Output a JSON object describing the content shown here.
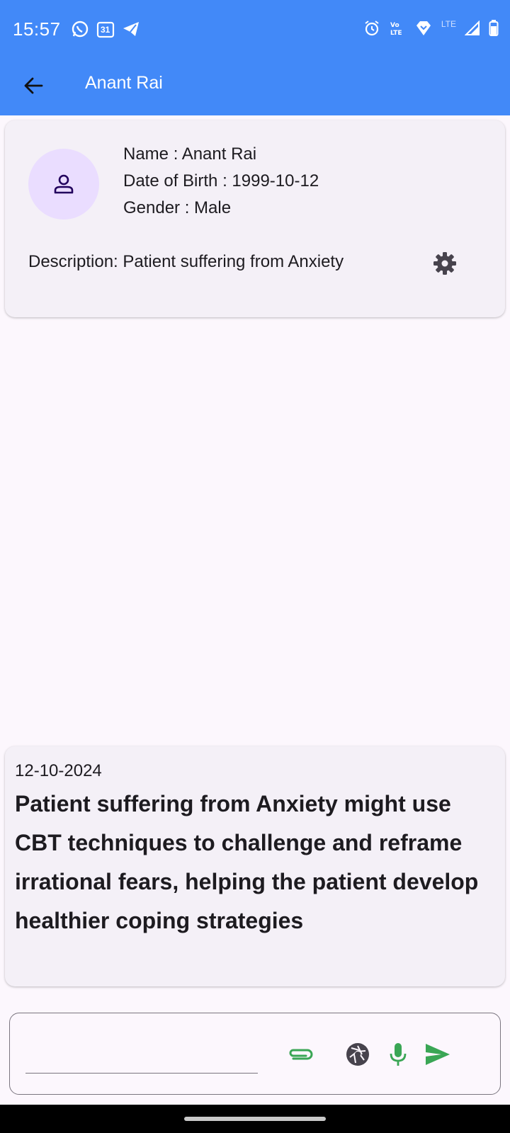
{
  "status_bar": {
    "time": "15:57",
    "left_icons": [
      "whatsapp-icon",
      "calendar-icon",
      "telegram-icon"
    ],
    "calendar_day": "31",
    "right_icons": [
      "alarm-icon",
      "volte-icon",
      "data-icon",
      "signal-icon",
      "battery-icon"
    ],
    "network_label": "LTE"
  },
  "app_bar": {
    "title": "Anant Rai",
    "back_icon": "arrow-back-icon",
    "background": "#4289f8"
  },
  "patient": {
    "avatar_icon": "person-icon",
    "name": "Name : Anant Rai",
    "dob": "Date of Birth : 1999-10-12",
    "gender": "Gender : Male",
    "description": "Description: Patient suffering from Anxiety",
    "settings_icon": "gear-icon"
  },
  "notes": [
    {
      "date": "12-10-2024",
      "text": "Patient suffering from Anxiety might use CBT techniques to challenge and reframe irrational fears, helping the patient develop healthier coping strategies"
    }
  ],
  "composer": {
    "value": "",
    "placeholder": "",
    "buttons": [
      "attach-icon",
      "camera-icon",
      "mic-icon",
      "send-icon"
    ],
    "accent": "#3aa655"
  }
}
